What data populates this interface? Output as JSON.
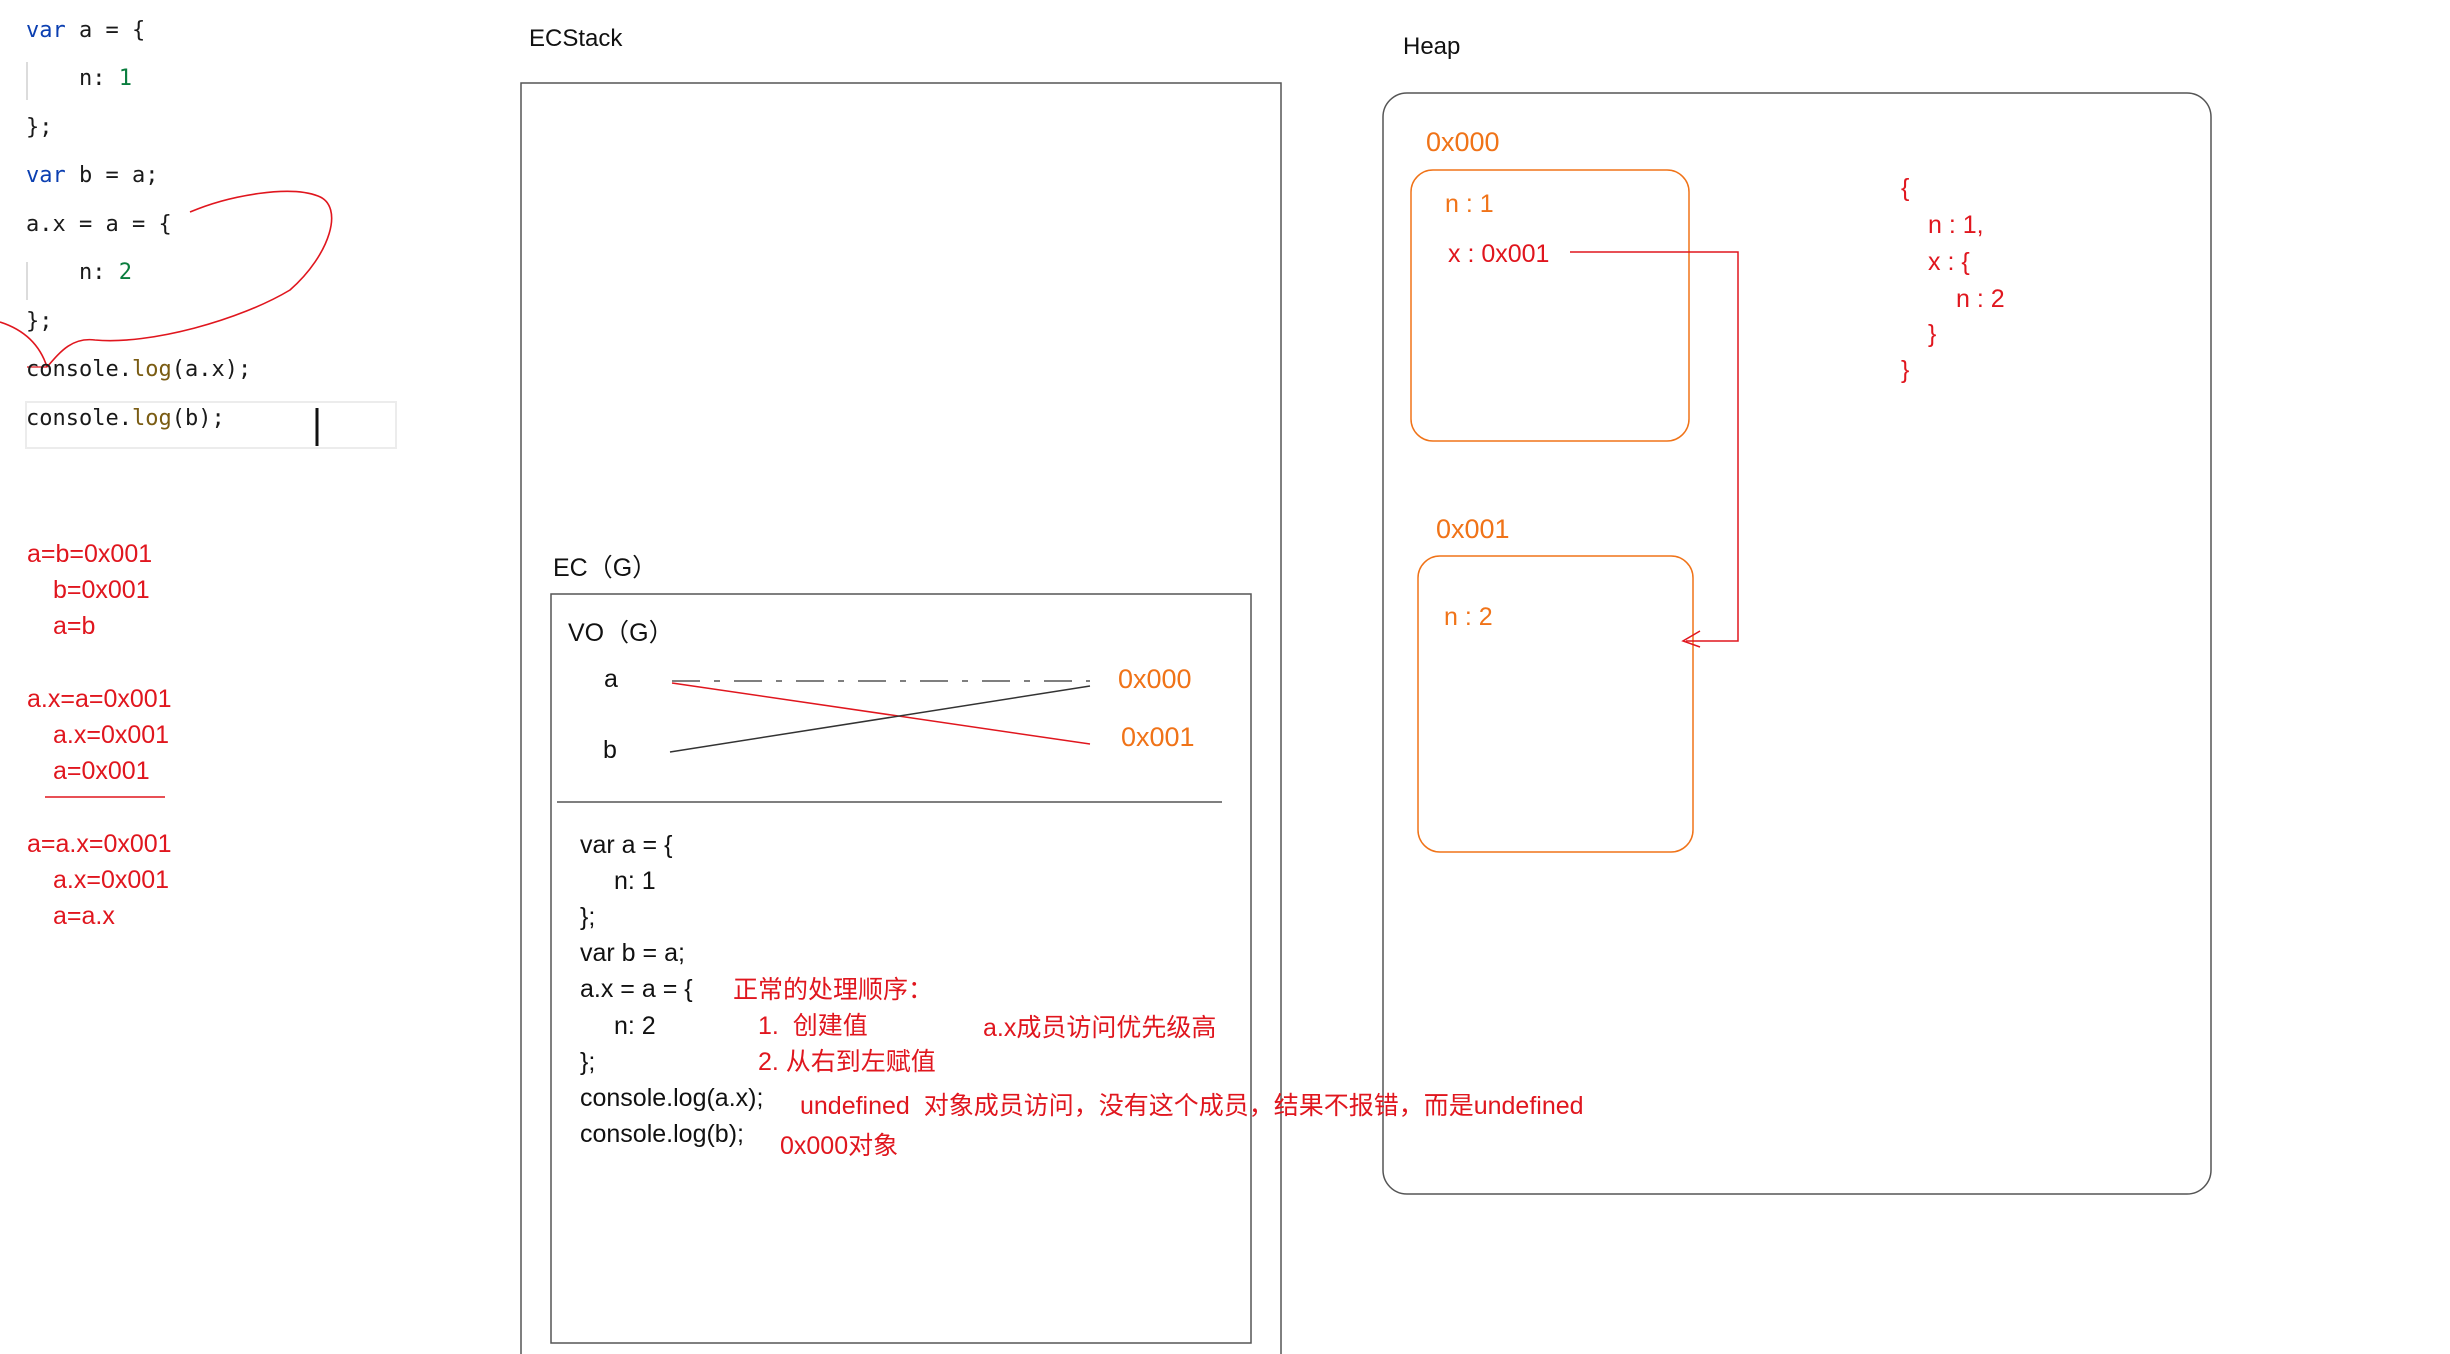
{
  "code_editor": {
    "lines": [
      [
        {
          "t": "var",
          "c": "kw"
        },
        {
          "t": " a = {",
          "c": ""
        }
      ],
      [
        {
          "t": "    n: ",
          "c": ""
        },
        {
          "t": "1",
          "c": "num"
        }
      ],
      [
        {
          "t": "};",
          "c": ""
        }
      ],
      [
        {
          "t": "var",
          "c": "kw"
        },
        {
          "t": " b = a;",
          "c": ""
        }
      ],
      [
        {
          "t": "a.x = a = {",
          "c": ""
        }
      ],
      [
        {
          "t": "    n: ",
          "c": ""
        },
        {
          "t": "2",
          "c": "num"
        }
      ],
      [
        {
          "t": "};",
          "c": ""
        }
      ],
      [
        {
          "t": "console.",
          "c": ""
        },
        {
          "t": "log",
          "c": "fn"
        },
        {
          "t": "(a.x);",
          "c": ""
        }
      ],
      [
        {
          "t": "console.",
          "c": ""
        },
        {
          "t": "log",
          "c": "fn"
        },
        {
          "t": "(b);",
          "c": ""
        }
      ]
    ]
  },
  "notes": {
    "group1": [
      "a=b=0x001",
      "b=0x001",
      "a=b"
    ],
    "group2": [
      "a.x=a=0x001",
      "a.x=0x001",
      "a=0x001"
    ],
    "group3": [
      "a=a.x=0x001",
      "a.x=0x001",
      "a=a.x"
    ]
  },
  "ecstack": {
    "title": "ECStack",
    "ec_label": "EC（G）",
    "vo_label": "VO（G）",
    "var_a": "a",
    "var_b": "b",
    "addr_a": "0x000",
    "addr_b": "0x001",
    "code_lines": [
      "var a = {",
      "n: 1",
      "};",
      "var b = a;",
      "a.x = a = {",
      "n: 2",
      "};",
      "console.log(a.x);",
      "console.log(b);"
    ],
    "annotations": {
      "order_title": "正常的处理顺序：",
      "step1": "1.  创建值",
      "step2": "2. 从右到左赋值",
      "priority": "a.x成员访问优先级高",
      "result_ax": "undefined  对象成员访问，没有这个成员，结果不报错，而是undefined",
      "result_b": "0x000对象"
    }
  },
  "heap": {
    "title": "Heap",
    "obj0_addr": "0x000",
    "obj0_n": "n : 1",
    "obj0_x": "x : 0x001",
    "obj1_addr": "0x001",
    "obj1_n": "n : 2",
    "literal": [
      "{",
      "n : 1,",
      "x : {",
      "n : 2",
      "}",
      "}"
    ]
  },
  "colors": {
    "annotation_red": "#e0161e",
    "heap_orange": "#f07318",
    "keyword_blue": "#0b3fb1",
    "number_green": "#0a7d3e",
    "function_brown": "#7a5c13"
  }
}
